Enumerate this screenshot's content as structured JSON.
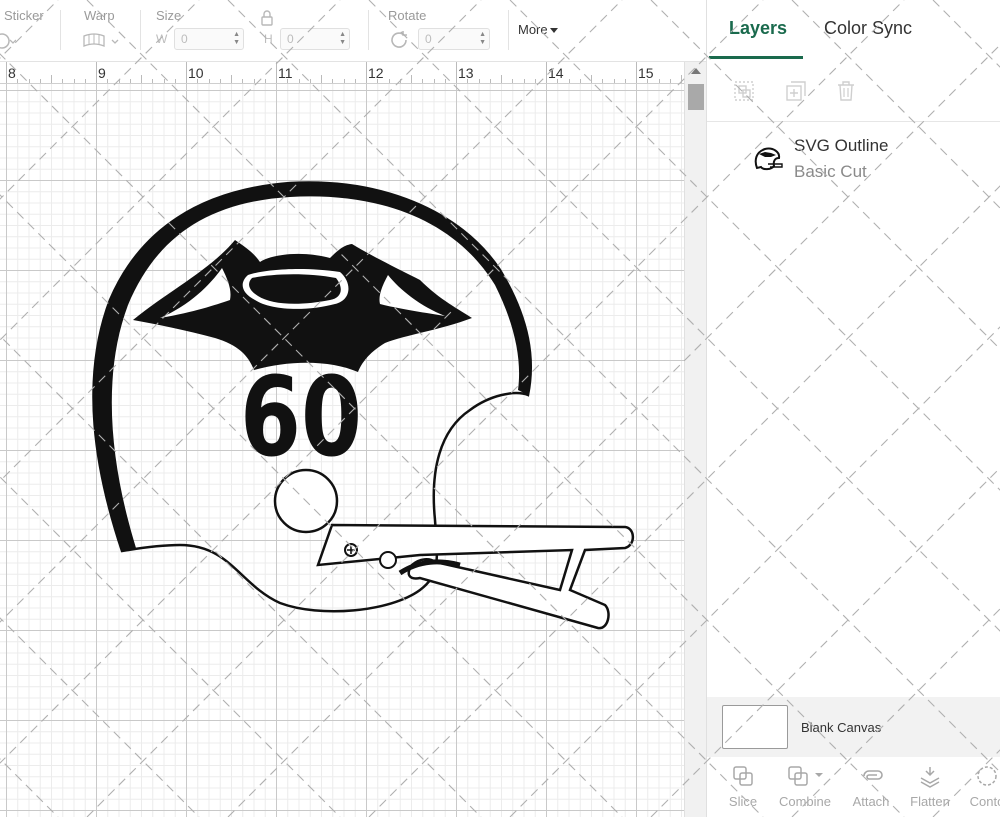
{
  "toolbar": {
    "sticker_label": "Sticker",
    "warp_label": "Warp",
    "size_label": "Size",
    "width_letter": "W",
    "width_value": "0",
    "height_letter": "H",
    "height_value": "0",
    "rotate_label": "Rotate",
    "rotate_value": "0",
    "more_label": "More"
  },
  "ruler": {
    "numbers": [
      "8",
      "9",
      "10",
      "11",
      "12",
      "13",
      "14",
      "15"
    ]
  },
  "canvas": {
    "design_number": "60"
  },
  "panel": {
    "tabs": [
      {
        "label": "Layers",
        "active": true
      },
      {
        "label": "Color Sync",
        "active": false
      }
    ],
    "layers": [
      {
        "name": "SVG Outline",
        "operation": "Basic Cut"
      }
    ],
    "blank_canvas_label": "Blank Canvas",
    "actions": [
      {
        "label": "Slice",
        "icon": "slice-icon"
      },
      {
        "label": "Combine",
        "icon": "combine-icon"
      },
      {
        "label": "Attach",
        "icon": "attach-icon"
      },
      {
        "label": "Flatten",
        "icon": "flatten-icon"
      },
      {
        "label": "Conto",
        "icon": "contour-icon"
      }
    ]
  },
  "colors": {
    "accent": "#1a6a4d",
    "grid_major": "#c9c9c9",
    "grid_minor": "#ececec"
  }
}
